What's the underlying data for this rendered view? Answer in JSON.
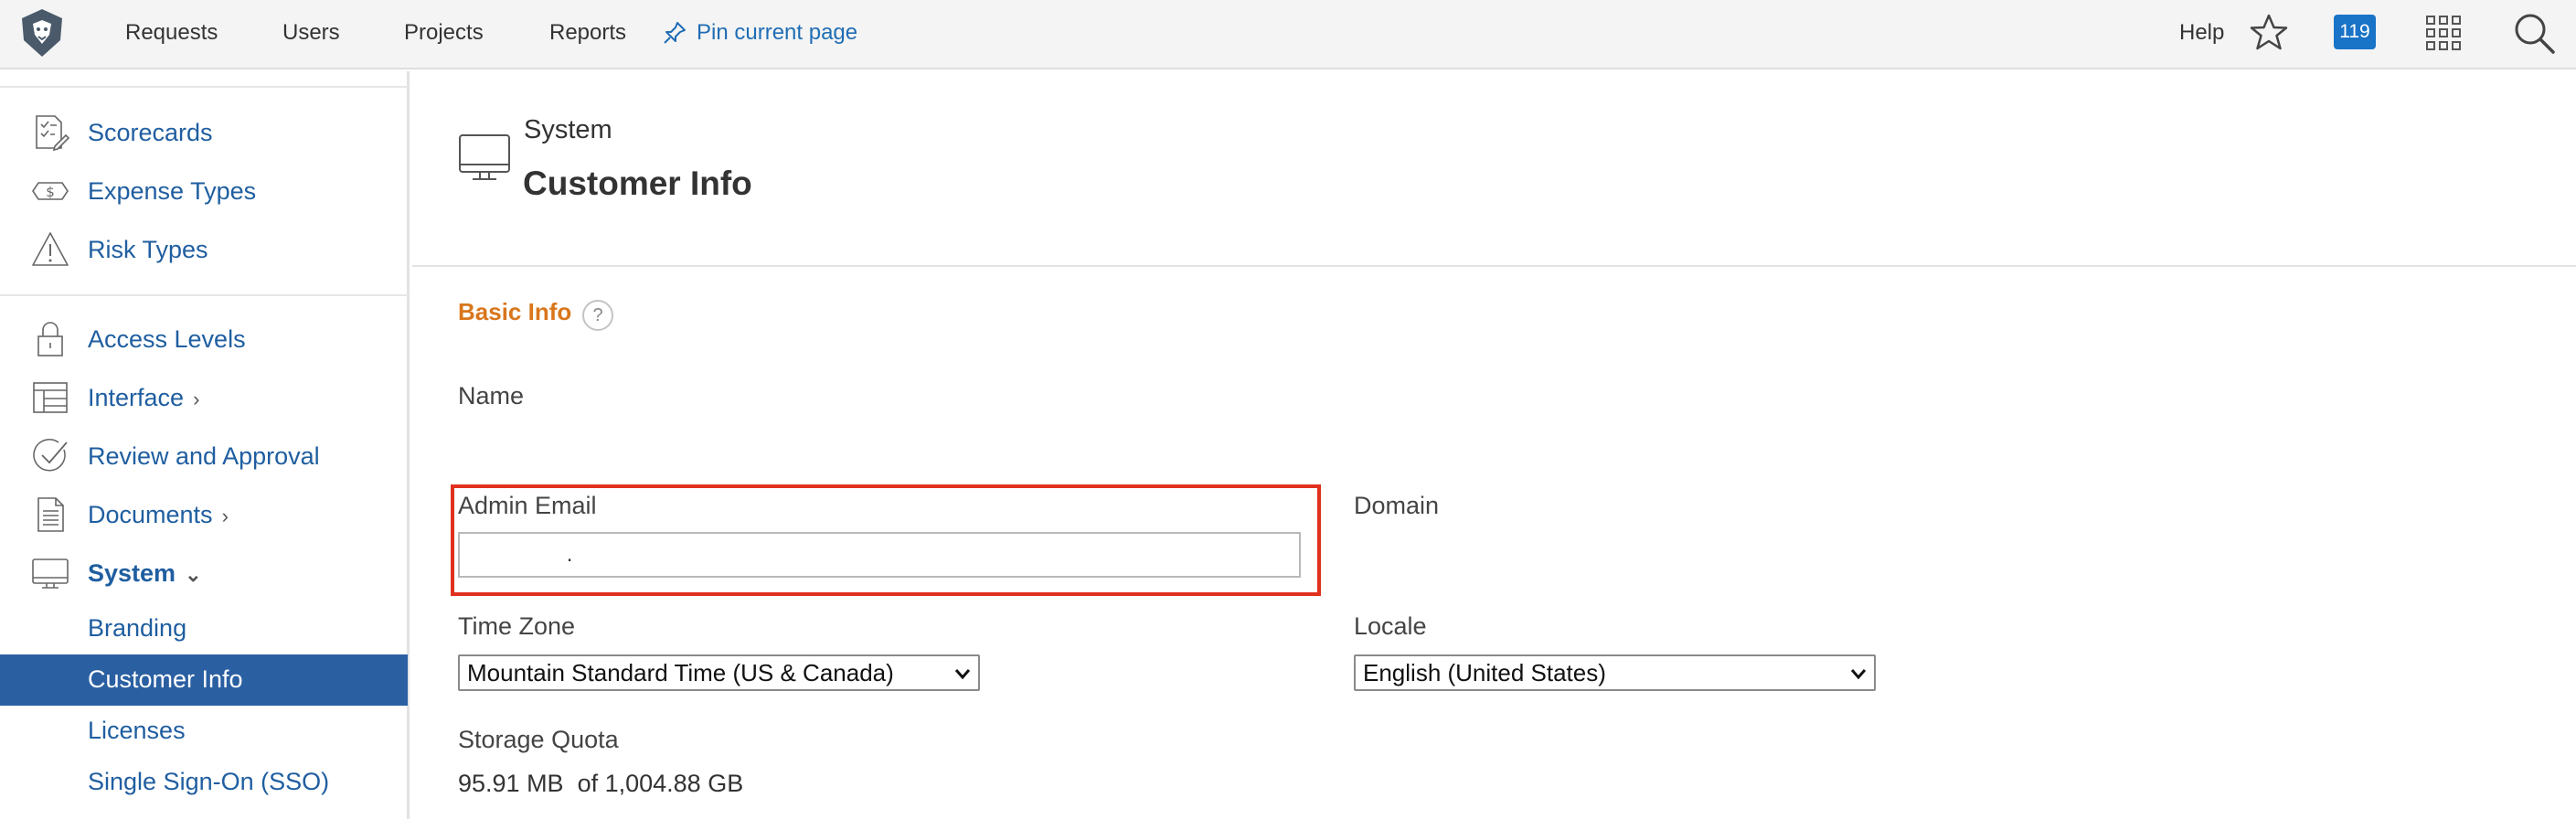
{
  "topbar": {
    "nav": [
      "Requests",
      "Users",
      "Projects",
      "Reports"
    ],
    "pin_label": "Pin current page",
    "help_label": "Help",
    "notification_count": "119",
    "icons": [
      "lion-logo-icon",
      "pin-icon",
      "star-icon",
      "apps-grid-icon",
      "search-icon"
    ]
  },
  "sidebar": {
    "items": [
      {
        "label": "Scorecards",
        "icon": "scorecard-icon"
      },
      {
        "label": "Expense Types",
        "icon": "money-icon"
      },
      {
        "label": "Risk Types",
        "icon": "warning-icon"
      },
      {
        "label": "Access Levels",
        "icon": "lock-icon"
      },
      {
        "label": "Interface",
        "icon": "layout-icon",
        "chevron": "›"
      },
      {
        "label": "Review and Approval",
        "icon": "checkmark-circle-icon"
      },
      {
        "label": "Documents",
        "icon": "document-icon",
        "chevron": "›"
      },
      {
        "label": "System",
        "icon": "monitor-icon",
        "chevron": "⌄"
      }
    ],
    "sub_items": [
      "Branding",
      "Customer Info",
      "Licenses",
      "Single Sign-On (SSO)"
    ],
    "selected": "Customer Info"
  },
  "page": {
    "breadcrumb": "System",
    "title": "Customer Info",
    "section_title": "Basic Info",
    "help_glyph": "?",
    "fields": {
      "name_label": "Name",
      "admin_email_label": "Admin Email",
      "admin_email_value": "                .",
      "domain_label": "Domain",
      "timezone_label": "Time Zone",
      "timezone_value": "Mountain Standard Time (US & Canada)",
      "locale_label": "Locale",
      "locale_value": "English (United States)",
      "storage_label": "Storage Quota",
      "storage_value": "95.91 MB  of 1,004.88 GB"
    }
  },
  "colors": {
    "link": "#1f5ea0",
    "selected_bg": "#2a5fa2",
    "section_title": "#d9761c",
    "highlight": "#e0301e",
    "badge": "#1973c7"
  }
}
